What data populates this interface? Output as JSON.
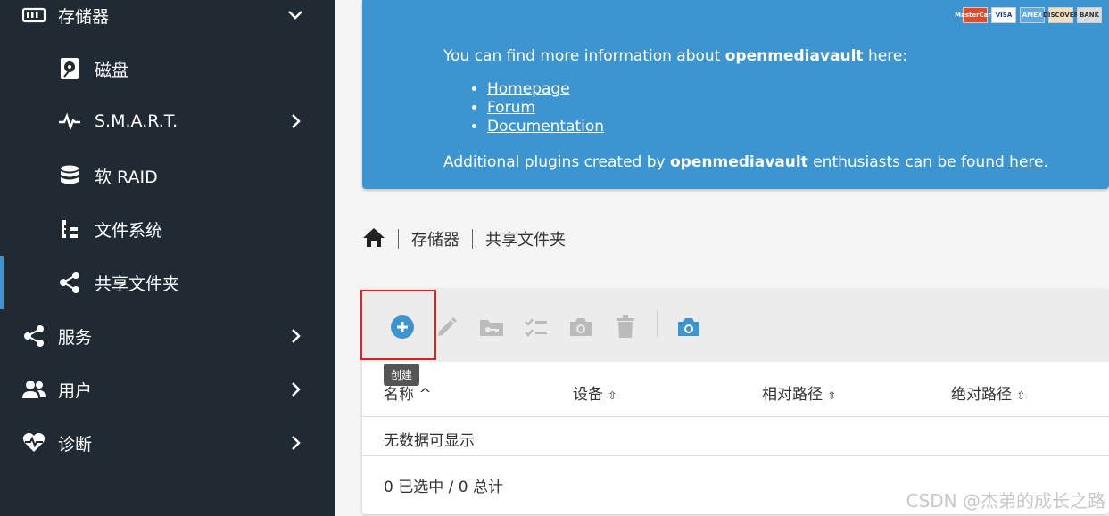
{
  "sidebar": {
    "items": [
      {
        "label": "存储器",
        "icon": "storage-icon",
        "chevron": "chevron-down-icon"
      },
      {
        "label": "磁盘",
        "icon": "disk-icon"
      },
      {
        "label": "S.M.A.R.T.",
        "icon": "pulse-icon",
        "chevron": "chevron-right-icon"
      },
      {
        "label": "软 RAID",
        "icon": "database-icon"
      },
      {
        "label": "文件系统",
        "icon": "filesystem-tree-icon"
      },
      {
        "label": "共享文件夹",
        "icon": "share-icon",
        "active": true
      },
      {
        "label": "服务",
        "icon": "share-icon",
        "chevron": "chevron-right-icon"
      },
      {
        "label": "用户",
        "icon": "users-icon",
        "chevron": "chevron-right-icon"
      },
      {
        "label": "诊断",
        "icon": "heartbeat-icon",
        "chevron": "chevron-right-icon"
      }
    ]
  },
  "info": {
    "line1_pre": "You can find more information about ",
    "line1_brand": "openmediavault",
    "line1_post": " here:",
    "links": [
      "Homepage",
      "Forum",
      "Documentation"
    ],
    "line2_pre": "Additional plugins created by ",
    "line2_brand": "openmediavault",
    "line2_mid": " enthusiasts can be found ",
    "line2_link": "here",
    "line2_post": ".",
    "cards": [
      "MasterCard",
      "VISA",
      "AMEX",
      "DISCOVER",
      "BANK"
    ]
  },
  "breadcrumb": {
    "home_icon": "home-icon",
    "items": [
      "存储器",
      "共享文件夹"
    ]
  },
  "toolbar": {
    "tooltip": "创建",
    "buttons": [
      "add-icon",
      "edit-icon",
      "folder-key-icon",
      "checklist-icon",
      "camera-icon",
      "delete-icon",
      "camera-icon"
    ]
  },
  "table": {
    "columns": [
      "名称",
      "设备",
      "相对路径",
      "绝对路径"
    ],
    "empty_text": "无数据可显示",
    "footer": "0 已选中 / 0 总计"
  },
  "watermark": "CSDN @杰弟的成长之路",
  "colors": {
    "sidebar_bg": "#1f2a33",
    "accent": "#3c95d0",
    "highlight": "#e02020"
  }
}
